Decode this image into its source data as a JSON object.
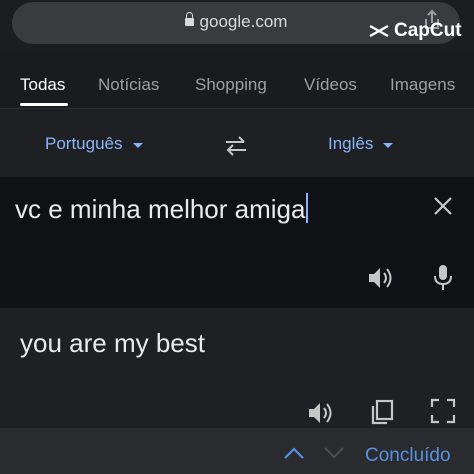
{
  "browser": {
    "url": "google.com"
  },
  "watermark": {
    "text": "CapCut"
  },
  "tabs": [
    {
      "label": "Todas",
      "active": true
    },
    {
      "label": "Notícias",
      "active": false
    },
    {
      "label": "Shopping",
      "active": false
    },
    {
      "label": "Vídeos",
      "active": false
    },
    {
      "label": "Imagens",
      "active": false
    }
  ],
  "languages": {
    "source": "Português",
    "target": "Inglês"
  },
  "input": {
    "text": "vc e minha melhor amiga"
  },
  "output": {
    "text": "you are my best"
  },
  "bottom": {
    "done_label": "Concluído"
  },
  "icons": {
    "lock": "lock-icon",
    "share": "share-icon",
    "capcut": "capcut-logo-icon",
    "swap": "swap-icon",
    "clear": "close-icon",
    "speaker": "speaker-icon",
    "mic": "mic-icon",
    "copy": "copy-icon",
    "expand": "fullscreen-icon",
    "up": "chevron-up-icon",
    "down": "chevron-down-icon"
  },
  "colors": {
    "accent": "#8ab4f8",
    "background": "#1a1b1e",
    "input_bg": "#101114",
    "done": "#5b8fe0"
  }
}
